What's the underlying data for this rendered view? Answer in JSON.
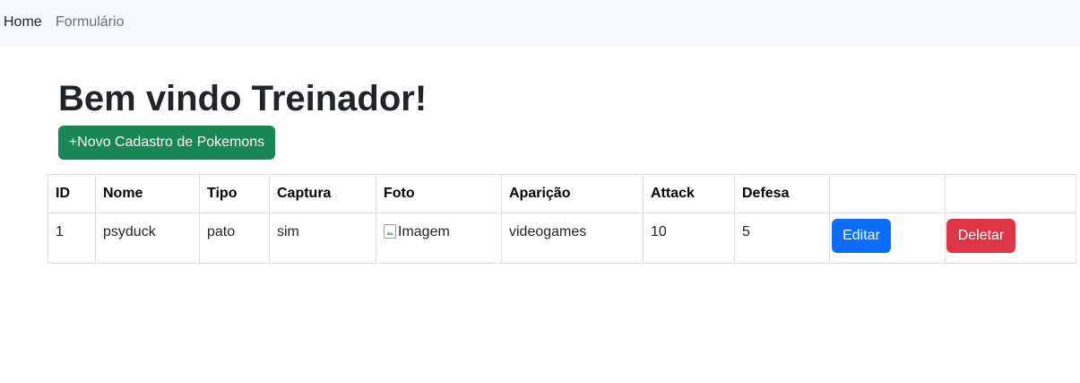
{
  "nav": {
    "home_label": "Home",
    "form_label": "Formulário"
  },
  "main": {
    "title": "Bem vindo Treinador!",
    "new_button_label": "+Novo Cadastro de Pokemons"
  },
  "table": {
    "headers": [
      "ID",
      "Nome",
      "Tipo",
      "Captura",
      "Foto",
      "Aparição",
      "Attack",
      "Defesa"
    ],
    "rows": [
      {
        "id": "1",
        "nome": "psyduck",
        "tipo": "pato",
        "captura": "sim",
        "foto_alt": "Imagem",
        "aparicao": "videogames",
        "attack": "10",
        "defesa": "5",
        "edit_label": "Editar",
        "delete_label": "Deletar"
      }
    ]
  },
  "colors": {
    "navbar_bg": "#f8f9fa",
    "success": "#198754",
    "primary": "#0d6efd",
    "danger": "#dc3545"
  }
}
